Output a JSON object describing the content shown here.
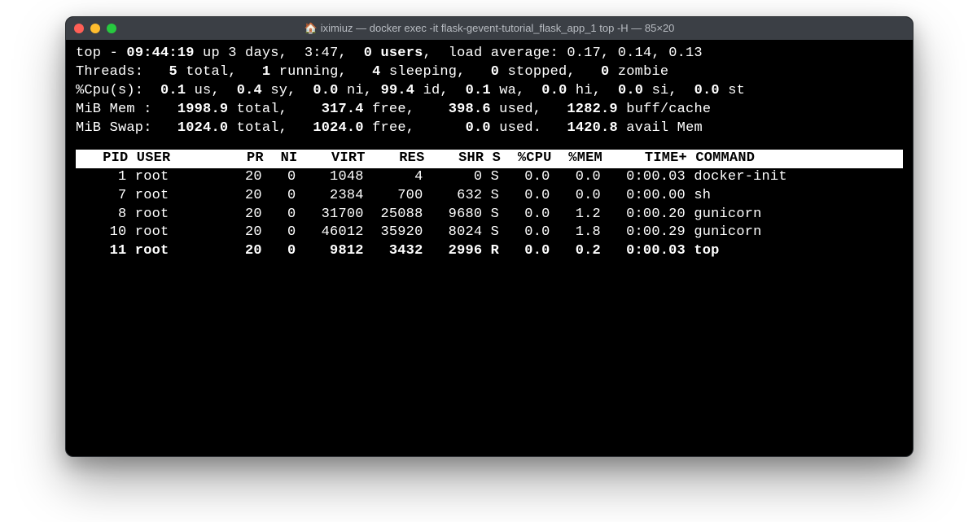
{
  "titlebar": {
    "home_icon": "🏠",
    "title": "iximiuz — docker exec -it flask-gevent-tutorial_flask_app_1 top -H — 85×20"
  },
  "top": {
    "time": "09:44:19",
    "uptime": "up 3 days,  3:47",
    "users": "0 users",
    "load_label": "load average:",
    "load": "0.17, 0.14, 0.13",
    "threads": {
      "label": "Threads:",
      "total": "5",
      "total_label": "total,",
      "running": "1",
      "running_label": "running,",
      "sleeping": "4",
      "sleeping_label": "sleeping,",
      "stopped": "0",
      "stopped_label": "stopped,",
      "zombie": "0",
      "zombie_label": "zombie"
    },
    "cpu": {
      "label": "%Cpu(s):",
      "us": "0.1",
      "us_label": "us,",
      "sy": "0.4",
      "sy_label": "sy,",
      "ni": "0.0",
      "ni_label": "ni,",
      "id": "99.4",
      "id_label": "id,",
      "wa": "0.1",
      "wa_label": "wa,",
      "hi": "0.0",
      "hi_label": "hi,",
      "si": "0.0",
      "si_label": "si,",
      "st": "0.0",
      "st_label": "st"
    },
    "mem": {
      "label": "MiB Mem :",
      "total": "1998.9",
      "total_label": "total,",
      "free": "317.4",
      "free_label": "free,",
      "used": "398.6",
      "used_label": "used,",
      "buff": "1282.9",
      "buff_label": "buff/cache"
    },
    "swap": {
      "label": "MiB Swap:",
      "total": "1024.0",
      "total_label": "total,",
      "free": "1024.0",
      "free_label": "free,",
      "used": "0.0",
      "used_label": "used.",
      "avail": "1420.8",
      "avail_label": "avail Mem"
    }
  },
  "columns": {
    "pid": "PID",
    "user": "USER",
    "pr": "PR",
    "ni": "NI",
    "virt": "VIRT",
    "res": "RES",
    "shr": "SHR",
    "s": "S",
    "cpu": "%CPU",
    "mem": "%MEM",
    "time": "TIME+",
    "command": "COMMAND"
  },
  "processes": [
    {
      "pid": "1",
      "user": "root",
      "pr": "20",
      "ni": "0",
      "virt": "1048",
      "res": "4",
      "shr": "0",
      "s": "S",
      "cpu": "0.0",
      "mem": "0.0",
      "time": "0:00.03",
      "command": "docker-init",
      "bold": false
    },
    {
      "pid": "7",
      "user": "root",
      "pr": "20",
      "ni": "0",
      "virt": "2384",
      "res": "700",
      "shr": "632",
      "s": "S",
      "cpu": "0.0",
      "mem": "0.0",
      "time": "0:00.00",
      "command": "sh",
      "bold": false
    },
    {
      "pid": "8",
      "user": "root",
      "pr": "20",
      "ni": "0",
      "virt": "31700",
      "res": "25088",
      "shr": "9680",
      "s": "S",
      "cpu": "0.0",
      "mem": "1.2",
      "time": "0:00.20",
      "command": "gunicorn",
      "bold": false
    },
    {
      "pid": "10",
      "user": "root",
      "pr": "20",
      "ni": "0",
      "virt": "46012",
      "res": "35920",
      "shr": "8024",
      "s": "S",
      "cpu": "0.0",
      "mem": "1.8",
      "time": "0:00.29",
      "command": "gunicorn",
      "bold": false
    },
    {
      "pid": "11",
      "user": "root",
      "pr": "20",
      "ni": "0",
      "virt": "9812",
      "res": "3432",
      "shr": "2996",
      "s": "R",
      "cpu": "0.0",
      "mem": "0.2",
      "time": "0:00.03",
      "command": "top",
      "bold": true
    }
  ]
}
